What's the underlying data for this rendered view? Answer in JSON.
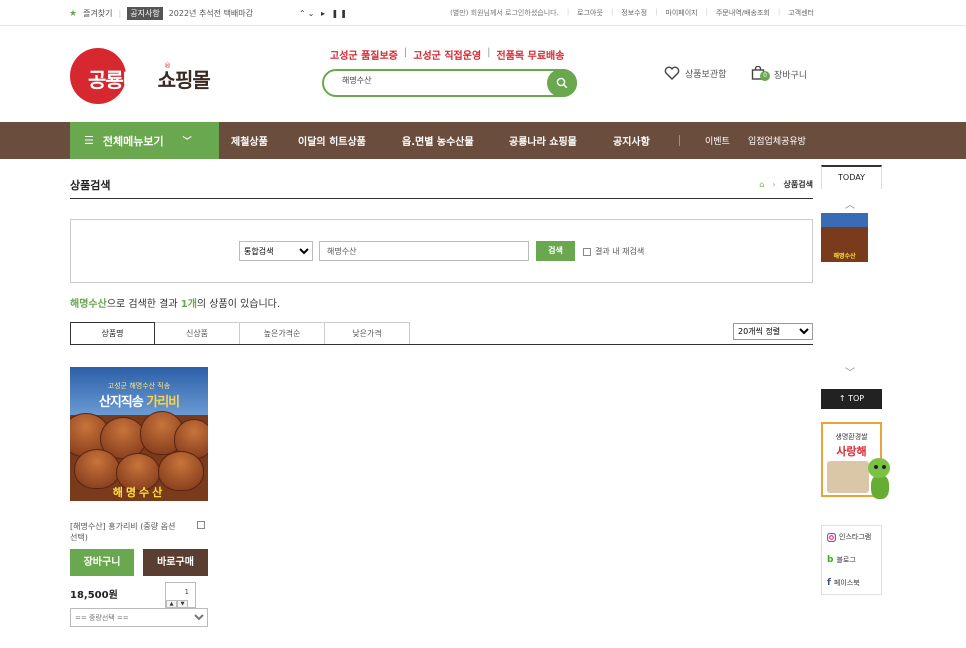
{
  "topbar": {
    "bookmark": "즐겨찾기",
    "notice_badge": "공지사항",
    "notice_text": "2022년 추석전 택배마감",
    "controls": "⌃⌄ ▸ ❚❚",
    "welcome": "(별만) 회원님께서 로그인하셨습니다.",
    "links": [
      "로그아웃",
      "정보수정",
      "마이페이지",
      "주문내역/배송조회",
      "고객센터"
    ]
  },
  "header": {
    "logo_text": "공룡나라",
    "logo_suffix": "쇼핑몰",
    "logo_mark": "®",
    "slogans": [
      "고성군 품질보증",
      "고성군 직접운영",
      "전품목 무료배송"
    ],
    "search_value": "해명수산",
    "wishlist_label": "상품보관함",
    "cart_label": "장바구니",
    "cart_count": "0"
  },
  "nav": {
    "all_menu": "전체메뉴보기",
    "items": [
      "제철상품",
      "이달의 히트상품",
      "읍.면별 농수산물",
      "공룡나라 쇼핑몰",
      "공지사항"
    ],
    "right_items": [
      "이벤트",
      "입점업체공유방"
    ]
  },
  "page": {
    "title": "상품검색",
    "breadcrumb_current": "상품검색"
  },
  "search_box": {
    "scope_selected": "통합검색",
    "keyword": "해명수산",
    "button": "검색",
    "within_label": "결과 내 재검색"
  },
  "result": {
    "keyword": "해명수산",
    "text1": "으로 검색한 결과 ",
    "count": "1개",
    "text2": "의 상품이 있습니다."
  },
  "tabs": [
    "상품명",
    "신상품",
    "높은가격순",
    "낮은가격"
  ],
  "sort_selected": "20개씩 정렬",
  "product": {
    "image_caption_top": "고성군 해명수산 직송",
    "image_caption_main": "산지직송",
    "image_caption_highlight": "가리비",
    "image_brand": "해명수산",
    "name": "[해명수산] 홍가리비 (중량 옵션선택)",
    "cart_button": "장바구니",
    "buy_button": "바로구매",
    "price": "18,500원",
    "qty": "1",
    "option_placeholder": "== 중량선택 =="
  },
  "sidebar": {
    "today_label": "TODAY",
    "today_thumb_label": "해명수산",
    "top_button": "TOP",
    "banner_line1": "생명환경쌀",
    "banner_line2": "사랑해",
    "social": [
      "인스타그램",
      "블로그",
      "페이스북"
    ]
  },
  "colors": {
    "green": "#6aa84f",
    "brown": "#6b4d3d",
    "red": "#d7282f"
  }
}
